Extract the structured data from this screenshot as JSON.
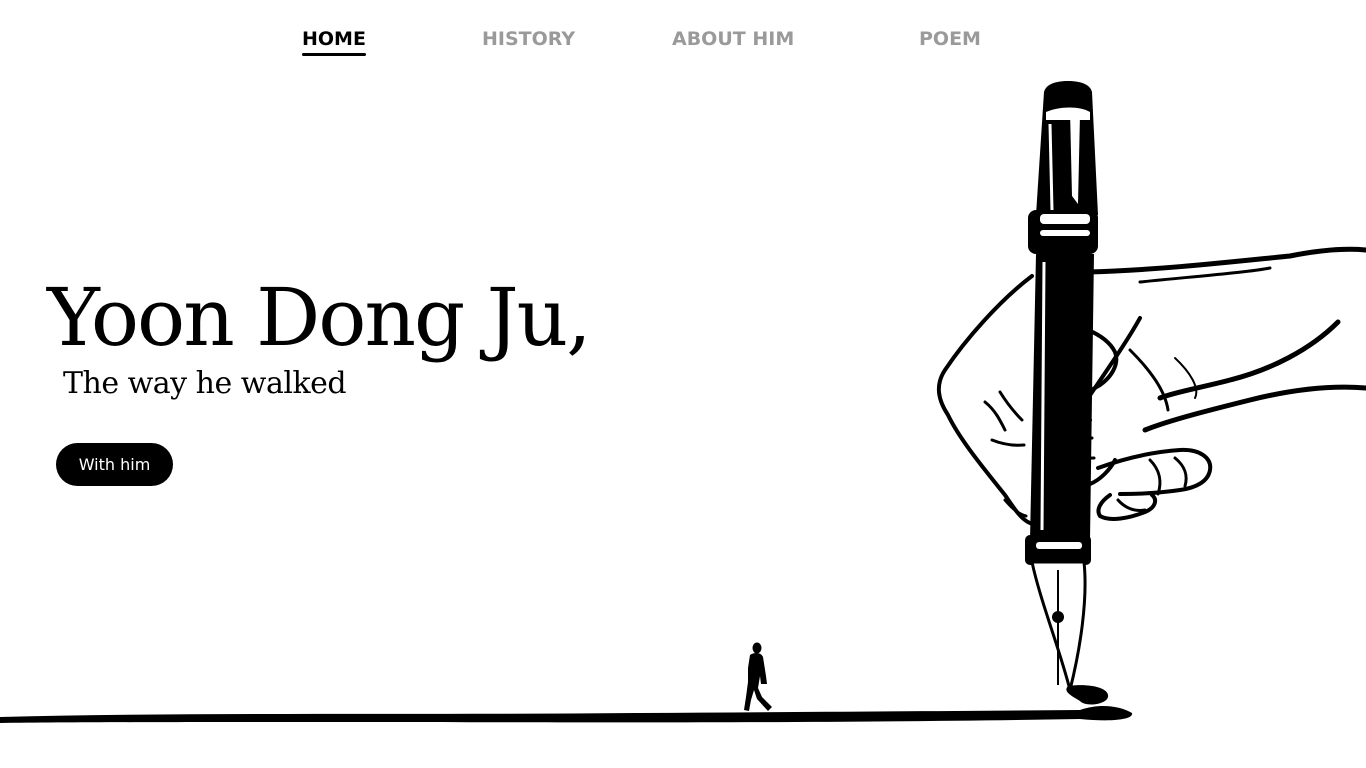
{
  "nav": {
    "items": [
      {
        "label": "HOME",
        "active": true
      },
      {
        "label": "HISTORY",
        "active": false
      },
      {
        "label": "ABOUT HIM",
        "active": false
      },
      {
        "label": "POEM",
        "active": false
      }
    ]
  },
  "hero": {
    "title": "Yoon Dong Ju,",
    "subtitle": "The way he walked",
    "button_label": "With him"
  },
  "illustration": {
    "hand": "hand-holding-pen-icon",
    "pen": "fountain-pen-icon",
    "walker": "walking-man-icon",
    "ink_line": "ink-line",
    "colors": {
      "ink": "#000000",
      "nav_active": "#000000",
      "nav_inactive": "#9a9a9a",
      "background": "#ffffff"
    }
  }
}
